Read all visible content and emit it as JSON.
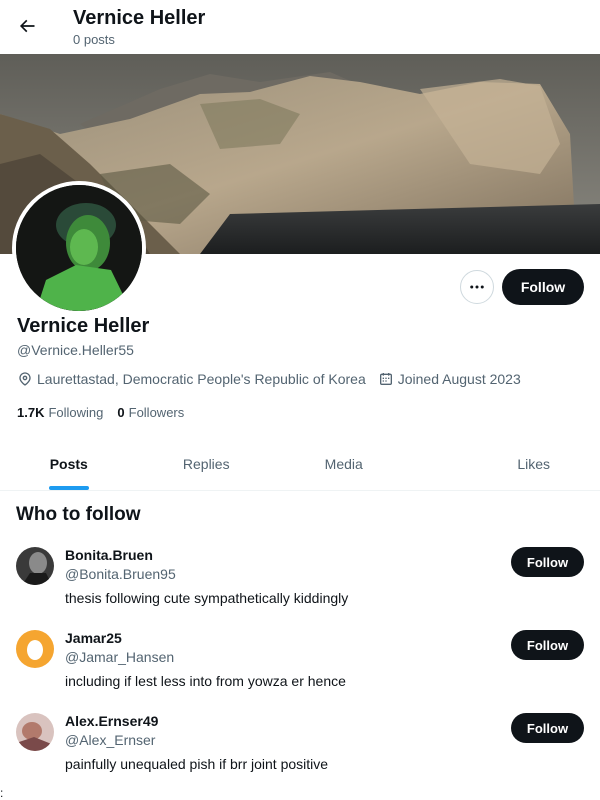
{
  "header": {
    "title": "Vernice Heller",
    "post_count": "0 posts",
    "back_icon": "arrow-left-icon"
  },
  "profile": {
    "display_name": "Vernice Heller",
    "handle": "@Vernice.Heller55",
    "location": "Laurettastad, Democratic People's Republic of Korea",
    "joined": "Joined August 2023",
    "following_count": "1.7K",
    "following_label": "Following",
    "followers_count": "0",
    "followers_label": "Followers",
    "follow_button": "Follow"
  },
  "tabs": [
    {
      "label": "Posts",
      "active": true
    },
    {
      "label": "Replies",
      "active": false
    },
    {
      "label": "Media",
      "active": false
    },
    {
      "label": "Likes",
      "active": false
    }
  ],
  "who_to_follow": {
    "title": "Who to follow",
    "users": [
      {
        "name": "Bonita.Bruen",
        "handle": "@Bonita.Bruen95",
        "bio": "thesis following cute sympathetically kiddingly",
        "button": "Follow"
      },
      {
        "name": "Jamar25",
        "handle": "@Jamar_Hansen",
        "bio": "including if lest less into from yowza er hence",
        "button": "Follow"
      },
      {
        "name": "Alex.Ernser49",
        "handle": "@Alex_Ernser",
        "bio": "painfully unequaled pish if brr joint positive",
        "button": "Follow"
      }
    ]
  },
  "stray_char": ":",
  "colors": {
    "accent": "#1d9bf0",
    "button_dark": "#0f1419",
    "secondary_text": "#536471",
    "border": "#cfd9de"
  }
}
